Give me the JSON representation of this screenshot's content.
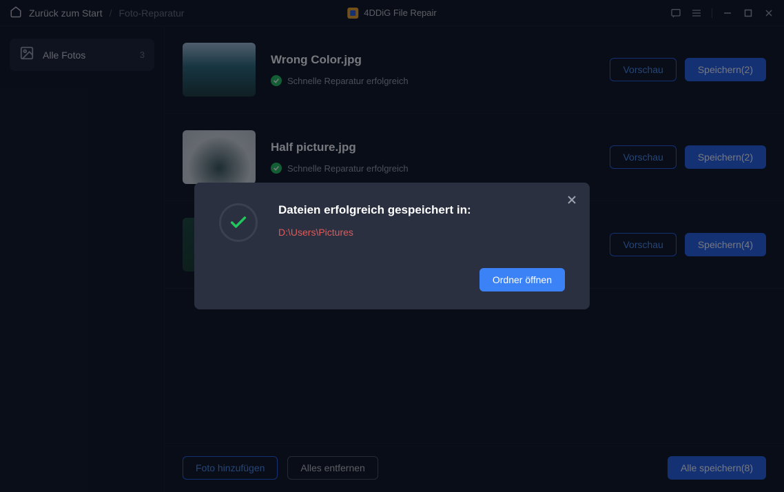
{
  "header": {
    "back": "Zurück zum Start",
    "section": "Foto-Reparatur",
    "app_name": "4DDiG File Repair"
  },
  "sidebar": {
    "all_photos": {
      "label": "Alle Fotos",
      "count": "3"
    }
  },
  "files": [
    {
      "name": "Wrong Color.jpg",
      "status": "Schnelle Reparatur erfolgreich",
      "preview": "Vorschau",
      "save": "Speichern(2)"
    },
    {
      "name": "Half picture.jpg",
      "status": "Schnelle Reparatur erfolgreich",
      "preview": "Vorschau",
      "save": "Speichern(2)"
    },
    {
      "name": "",
      "status": "",
      "preview": "Vorschau",
      "save": "Speichern(4)"
    }
  ],
  "footer": {
    "add": "Foto hinzufügen",
    "remove_all": "Alles entfernen",
    "save_all": "Alle speichern(8)"
  },
  "modal": {
    "title": "Dateien erfolgreich gespeichert in:",
    "path": "D:\\Users\\Pictures",
    "open": "Ordner öffnen"
  }
}
